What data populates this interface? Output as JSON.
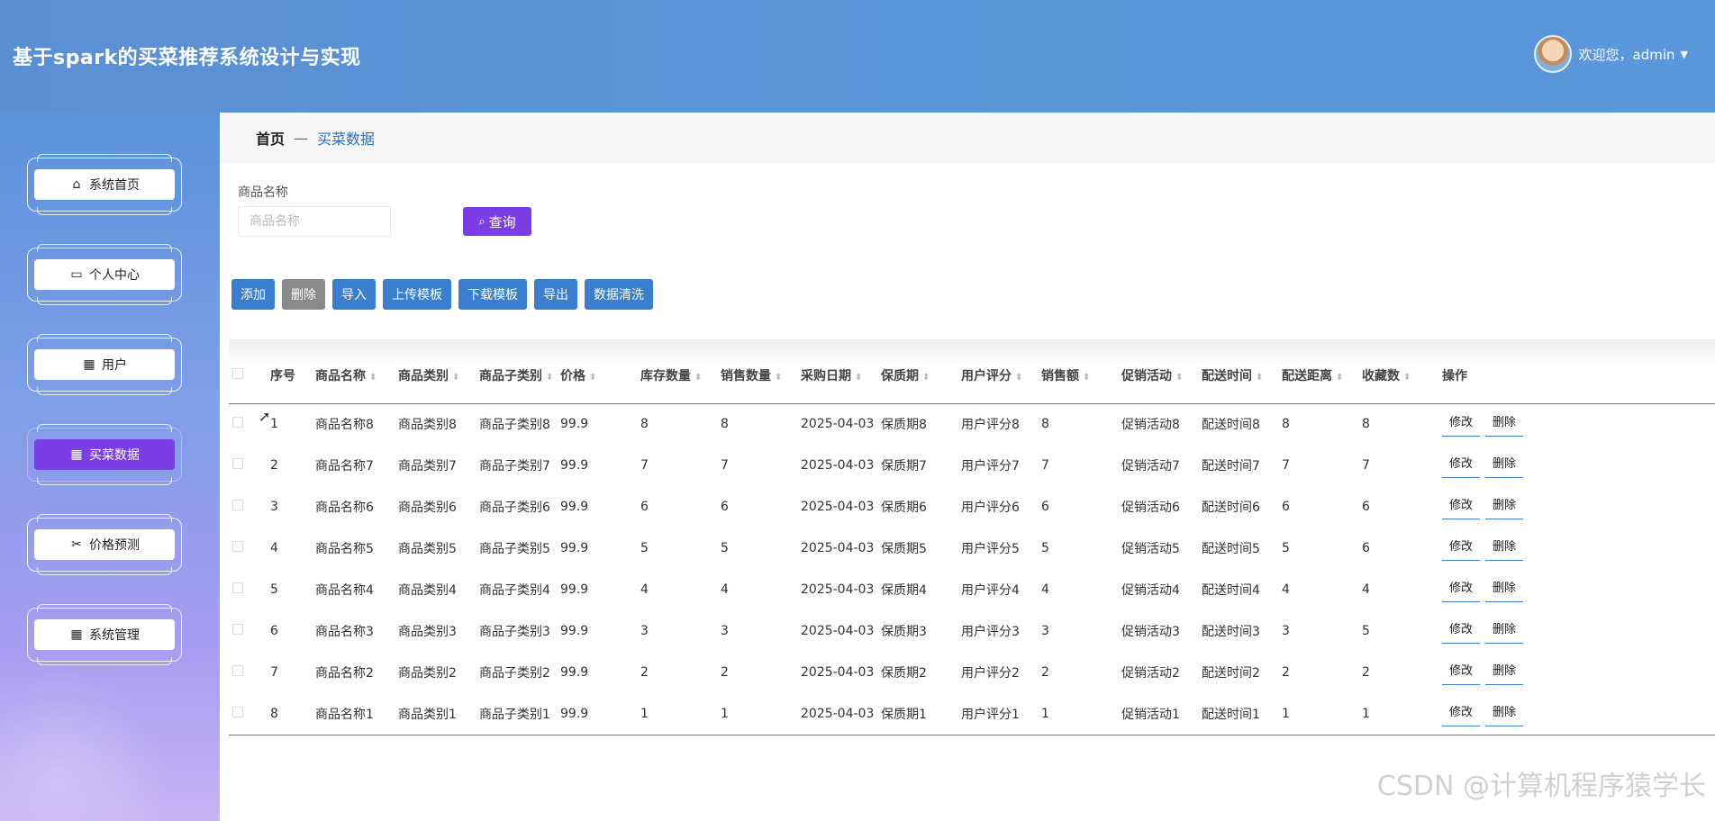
{
  "header": {
    "title": "基于spark的买菜推荐系统设计与实现",
    "greeting": "欢迎您，admin"
  },
  "sidebar": {
    "items": [
      {
        "label": "系统首页",
        "icon": "home-icon"
      },
      {
        "label": "个人中心",
        "icon": "card-icon"
      },
      {
        "label": "用户",
        "icon": "grid-icon"
      },
      {
        "label": "买菜数据",
        "icon": "grid-icon",
        "active": true
      },
      {
        "label": "价格预测",
        "icon": "ticket-icon"
      },
      {
        "label": "系统管理",
        "icon": "grid-icon"
      }
    ]
  },
  "breadcrumb": {
    "home": "首页",
    "separator": "—",
    "current": "买菜数据"
  },
  "search": {
    "label": "商品名称",
    "placeholder": "商品名称",
    "button": "查询"
  },
  "toolbar": {
    "add": "添加",
    "delete": "删除",
    "import": "导入",
    "upload_template": "上传模板",
    "download_template": "下载模板",
    "export": "导出",
    "clean": "数据清洗"
  },
  "table": {
    "headers": [
      "序号",
      "商品名称",
      "商品类别",
      "商品子类别",
      "价格",
      "库存数量",
      "销售数量",
      "采购日期",
      "保质期",
      "用户评分",
      "销售额",
      "促销活动",
      "配送时间",
      "配送距离",
      "收藏数",
      "操作"
    ],
    "actions": {
      "edit": "修改",
      "delete": "删除"
    },
    "rows": [
      [
        "1",
        "商品名称8",
        "商品类别8",
        "商品子类别8",
        "99.9",
        "8",
        "8",
        "2025-04-03",
        "保质期8",
        "用户评分8",
        "8",
        "促销活动8",
        "配送时间8",
        "8",
        "8"
      ],
      [
        "2",
        "商品名称7",
        "商品类别7",
        "商品子类别7",
        "99.9",
        "7",
        "7",
        "2025-04-03",
        "保质期7",
        "用户评分7",
        "7",
        "促销活动7",
        "配送时间7",
        "7",
        "7"
      ],
      [
        "3",
        "商品名称6",
        "商品类别6",
        "商品子类别6",
        "99.9",
        "6",
        "6",
        "2025-04-03",
        "保质期6",
        "用户评分6",
        "6",
        "促销活动6",
        "配送时间6",
        "6",
        "6"
      ],
      [
        "4",
        "商品名称5",
        "商品类别5",
        "商品子类别5",
        "99.9",
        "5",
        "5",
        "2025-04-03",
        "保质期5",
        "用户评分5",
        "5",
        "促销活动5",
        "配送时间5",
        "5",
        "6"
      ],
      [
        "5",
        "商品名称4",
        "商品类别4",
        "商品子类别4",
        "99.9",
        "4",
        "4",
        "2025-04-03",
        "保质期4",
        "用户评分4",
        "4",
        "促销活动4",
        "配送时间4",
        "4",
        "4"
      ],
      [
        "6",
        "商品名称3",
        "商品类别3",
        "商品子类别3",
        "99.9",
        "3",
        "3",
        "2025-04-03",
        "保质期3",
        "用户评分3",
        "3",
        "促销活动3",
        "配送时间3",
        "3",
        "5"
      ],
      [
        "7",
        "商品名称2",
        "商品类别2",
        "商品子类别2",
        "99.9",
        "2",
        "2",
        "2025-04-03",
        "保质期2",
        "用户评分2",
        "2",
        "促销活动2",
        "配送时间2",
        "2",
        "2"
      ],
      [
        "8",
        "商品名称1",
        "商品类别1",
        "商品子类别1",
        "99.9",
        "1",
        "1",
        "2025-04-03",
        "保质期1",
        "用户评分1",
        "1",
        "促销活动1",
        "配送时间1",
        "1",
        "1"
      ]
    ]
  },
  "watermark": "CSDN @计算机程序猿学长",
  "colors": {
    "header": "#5b8fd4",
    "accent": "#7b3ee6",
    "button": "#3a7fcf"
  }
}
